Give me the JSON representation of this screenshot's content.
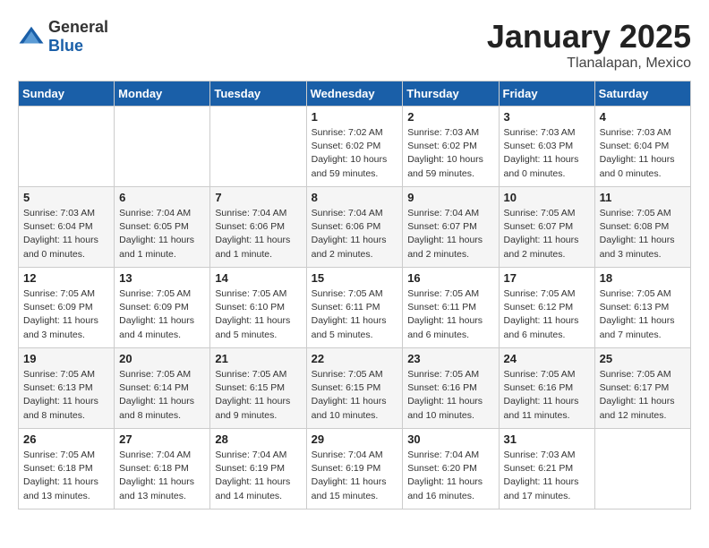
{
  "logo": {
    "general": "General",
    "blue": "Blue"
  },
  "title": "January 2025",
  "subtitle": "Tlanalapan, Mexico",
  "weekdays": [
    "Sunday",
    "Monday",
    "Tuesday",
    "Wednesday",
    "Thursday",
    "Friday",
    "Saturday"
  ],
  "weeks": [
    [
      {
        "day": "",
        "info": ""
      },
      {
        "day": "",
        "info": ""
      },
      {
        "day": "",
        "info": ""
      },
      {
        "day": "1",
        "info": "Sunrise: 7:02 AM\nSunset: 6:02 PM\nDaylight: 10 hours\nand 59 minutes."
      },
      {
        "day": "2",
        "info": "Sunrise: 7:03 AM\nSunset: 6:02 PM\nDaylight: 10 hours\nand 59 minutes."
      },
      {
        "day": "3",
        "info": "Sunrise: 7:03 AM\nSunset: 6:03 PM\nDaylight: 11 hours\nand 0 minutes."
      },
      {
        "day": "4",
        "info": "Sunrise: 7:03 AM\nSunset: 6:04 PM\nDaylight: 11 hours\nand 0 minutes."
      }
    ],
    [
      {
        "day": "5",
        "info": "Sunrise: 7:03 AM\nSunset: 6:04 PM\nDaylight: 11 hours\nand 0 minutes."
      },
      {
        "day": "6",
        "info": "Sunrise: 7:04 AM\nSunset: 6:05 PM\nDaylight: 11 hours\nand 1 minute."
      },
      {
        "day": "7",
        "info": "Sunrise: 7:04 AM\nSunset: 6:06 PM\nDaylight: 11 hours\nand 1 minute."
      },
      {
        "day": "8",
        "info": "Sunrise: 7:04 AM\nSunset: 6:06 PM\nDaylight: 11 hours\nand 2 minutes."
      },
      {
        "day": "9",
        "info": "Sunrise: 7:04 AM\nSunset: 6:07 PM\nDaylight: 11 hours\nand 2 minutes."
      },
      {
        "day": "10",
        "info": "Sunrise: 7:05 AM\nSunset: 6:07 PM\nDaylight: 11 hours\nand 2 minutes."
      },
      {
        "day": "11",
        "info": "Sunrise: 7:05 AM\nSunset: 6:08 PM\nDaylight: 11 hours\nand 3 minutes."
      }
    ],
    [
      {
        "day": "12",
        "info": "Sunrise: 7:05 AM\nSunset: 6:09 PM\nDaylight: 11 hours\nand 3 minutes."
      },
      {
        "day": "13",
        "info": "Sunrise: 7:05 AM\nSunset: 6:09 PM\nDaylight: 11 hours\nand 4 minutes."
      },
      {
        "day": "14",
        "info": "Sunrise: 7:05 AM\nSunset: 6:10 PM\nDaylight: 11 hours\nand 5 minutes."
      },
      {
        "day": "15",
        "info": "Sunrise: 7:05 AM\nSunset: 6:11 PM\nDaylight: 11 hours\nand 5 minutes."
      },
      {
        "day": "16",
        "info": "Sunrise: 7:05 AM\nSunset: 6:11 PM\nDaylight: 11 hours\nand 6 minutes."
      },
      {
        "day": "17",
        "info": "Sunrise: 7:05 AM\nSunset: 6:12 PM\nDaylight: 11 hours\nand 6 minutes."
      },
      {
        "day": "18",
        "info": "Sunrise: 7:05 AM\nSunset: 6:13 PM\nDaylight: 11 hours\nand 7 minutes."
      }
    ],
    [
      {
        "day": "19",
        "info": "Sunrise: 7:05 AM\nSunset: 6:13 PM\nDaylight: 11 hours\nand 8 minutes."
      },
      {
        "day": "20",
        "info": "Sunrise: 7:05 AM\nSunset: 6:14 PM\nDaylight: 11 hours\nand 8 minutes."
      },
      {
        "day": "21",
        "info": "Sunrise: 7:05 AM\nSunset: 6:15 PM\nDaylight: 11 hours\nand 9 minutes."
      },
      {
        "day": "22",
        "info": "Sunrise: 7:05 AM\nSunset: 6:15 PM\nDaylight: 11 hours\nand 10 minutes."
      },
      {
        "day": "23",
        "info": "Sunrise: 7:05 AM\nSunset: 6:16 PM\nDaylight: 11 hours\nand 10 minutes."
      },
      {
        "day": "24",
        "info": "Sunrise: 7:05 AM\nSunset: 6:16 PM\nDaylight: 11 hours\nand 11 minutes."
      },
      {
        "day": "25",
        "info": "Sunrise: 7:05 AM\nSunset: 6:17 PM\nDaylight: 11 hours\nand 12 minutes."
      }
    ],
    [
      {
        "day": "26",
        "info": "Sunrise: 7:05 AM\nSunset: 6:18 PM\nDaylight: 11 hours\nand 13 minutes."
      },
      {
        "day": "27",
        "info": "Sunrise: 7:04 AM\nSunset: 6:18 PM\nDaylight: 11 hours\nand 13 minutes."
      },
      {
        "day": "28",
        "info": "Sunrise: 7:04 AM\nSunset: 6:19 PM\nDaylight: 11 hours\nand 14 minutes."
      },
      {
        "day": "29",
        "info": "Sunrise: 7:04 AM\nSunset: 6:19 PM\nDaylight: 11 hours\nand 15 minutes."
      },
      {
        "day": "30",
        "info": "Sunrise: 7:04 AM\nSunset: 6:20 PM\nDaylight: 11 hours\nand 16 minutes."
      },
      {
        "day": "31",
        "info": "Sunrise: 7:03 AM\nSunset: 6:21 PM\nDaylight: 11 hours\nand 17 minutes."
      },
      {
        "day": "",
        "info": ""
      }
    ]
  ]
}
